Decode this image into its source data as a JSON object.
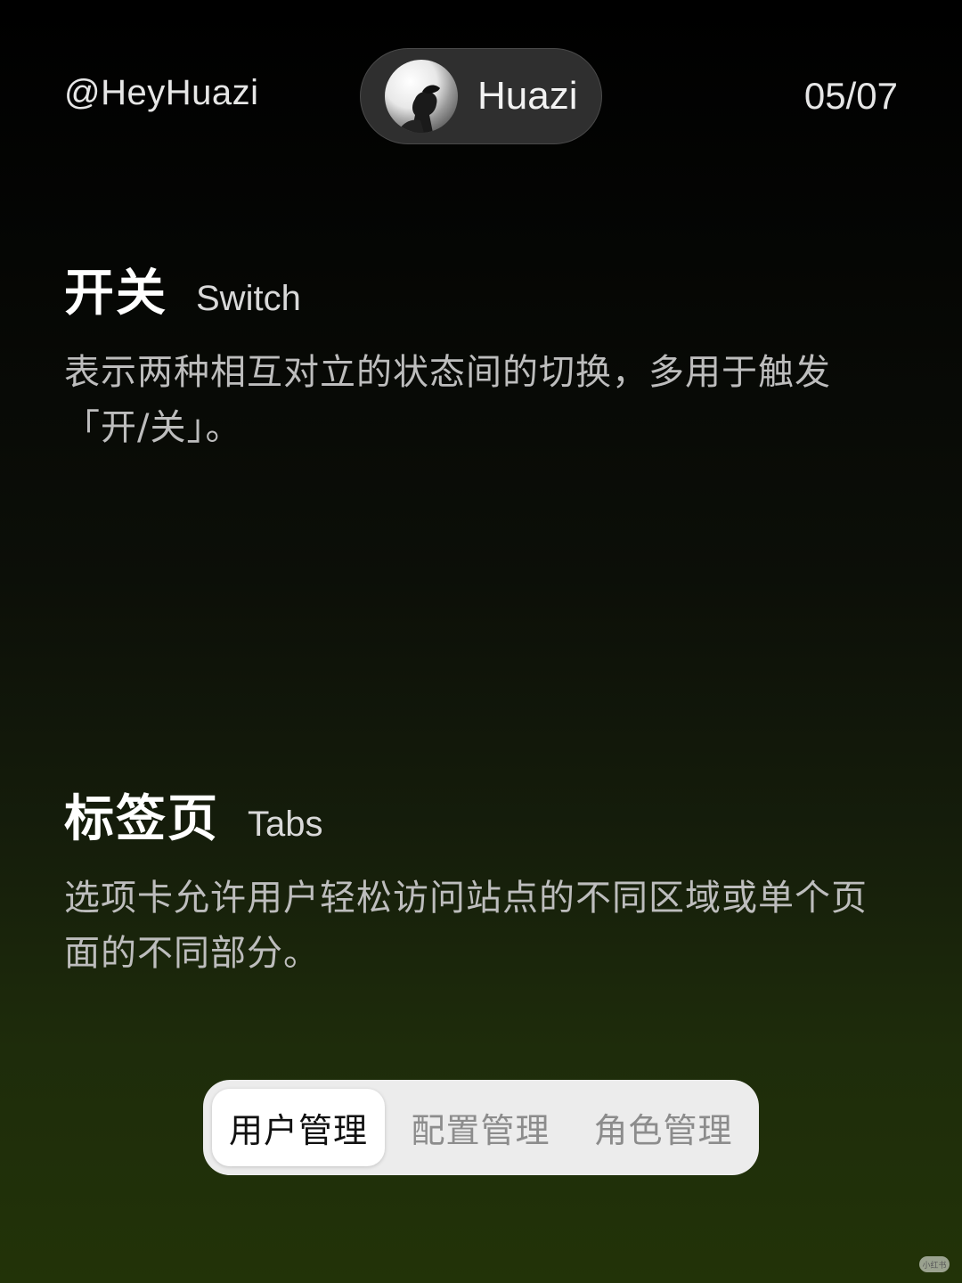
{
  "header": {
    "handle": "@HeyHuazi",
    "profile_name": "Huazi",
    "page_indicator": "05/07"
  },
  "sections": [
    {
      "title_zh": "开关",
      "title_en": "Switch",
      "description": "表示两种相互对立的状态间的切换，多用于触发「开/关」。"
    },
    {
      "title_zh": "标签页",
      "title_en": "Tabs",
      "description": "选项卡允许用户轻松访问站点的不同区域或单个页面的不同部分。"
    }
  ],
  "tabs": {
    "items": [
      "用户管理",
      "配置管理",
      "角色管理"
    ],
    "active": "用户管理"
  },
  "watermark": "小红书",
  "colors": {
    "background_top": "#000000",
    "background_bottom": "#223308",
    "pill_bg": "#2f2f2f",
    "tabs_bg": "#ececec",
    "tab_active_bg": "#ffffff",
    "tab_inactive_text": "#8c8c8c"
  }
}
